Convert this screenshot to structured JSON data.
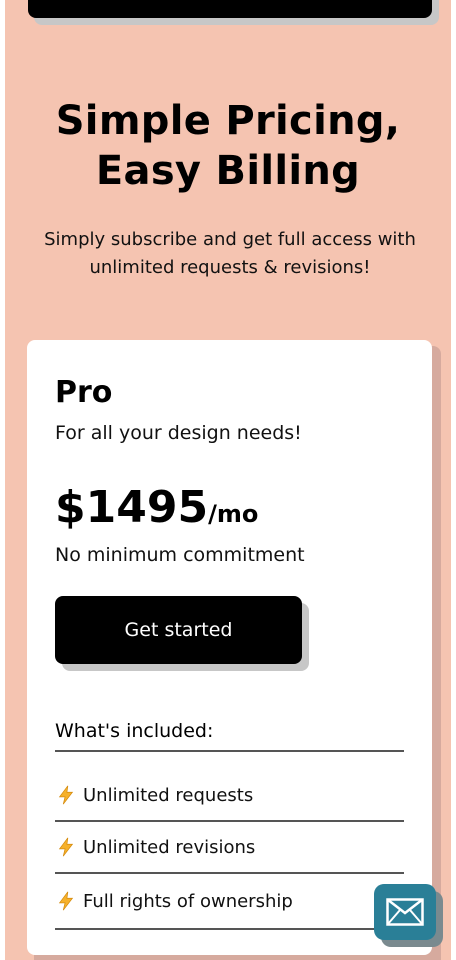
{
  "hero": {
    "title_line1": "Simple Pricing,",
    "title_line2": "Easy Billing",
    "subtitle": "Simply subscribe and get full access with unlimited requests & revisions!"
  },
  "plan": {
    "name": "Pro",
    "description": "For all your design needs!",
    "price": "$1495",
    "period": "/mo",
    "commitment": "No minimum commitment",
    "cta_label": "Get started",
    "included_heading": "What's included:",
    "features": [
      {
        "label": "Unlimited requests",
        "icon": "lightning-bolt-icon"
      },
      {
        "label": "Unlimited revisions",
        "icon": "lightning-bolt-icon"
      },
      {
        "label": "Full rights of ownership",
        "icon": "lightning-bolt-icon"
      }
    ]
  },
  "contact": {
    "icon": "mail-icon"
  },
  "colors": {
    "background": "#f5c4b1",
    "card": "#ffffff",
    "primary": "#000000",
    "fab": "#2a7f97",
    "bolt": "#f6b12b"
  }
}
